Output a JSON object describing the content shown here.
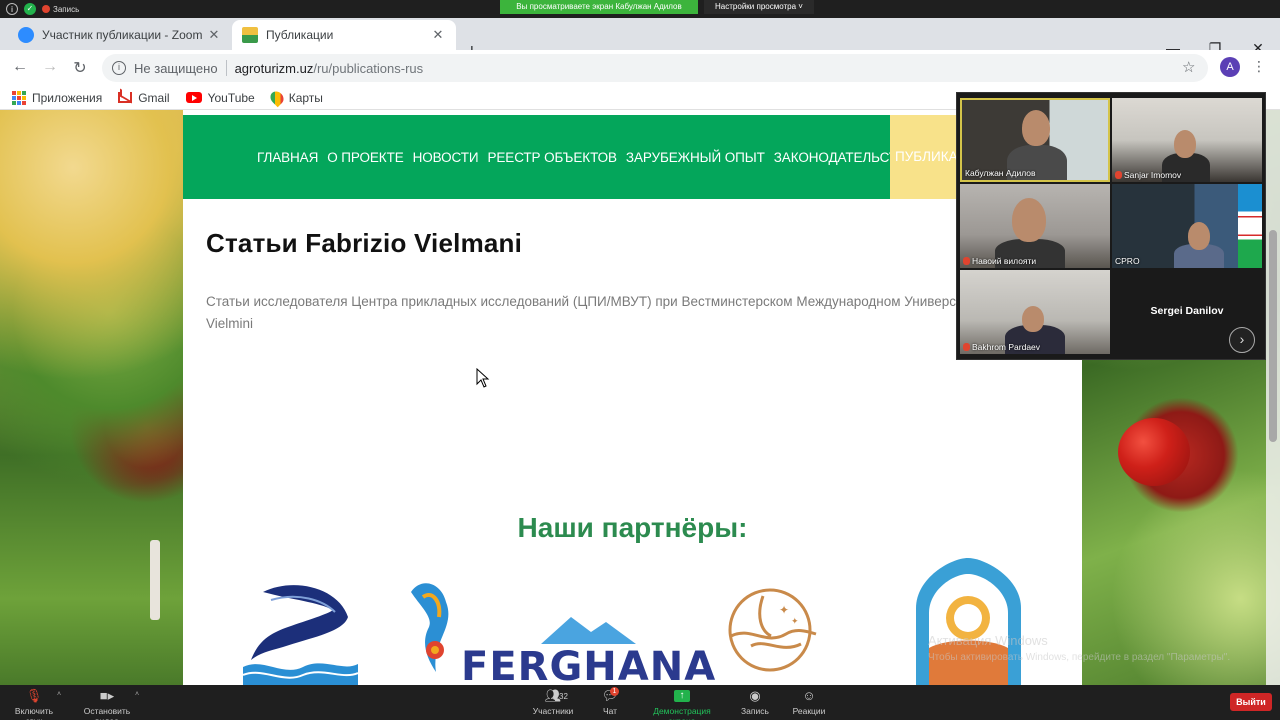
{
  "zoom_top": {
    "record_label": "Запись",
    "share_banner": "Вы просматриваете экран Кабулжан Адилов",
    "view_settings": "Настройки просмотра"
  },
  "tabs": [
    {
      "title": "Участник публикации - Zoom"
    },
    {
      "title": "Публикации"
    }
  ],
  "addressbar": {
    "insecure_label": "Не защищено",
    "url_host": "agroturizm.uz",
    "url_path": "/ru/publications-rus",
    "profile_initial": "A"
  },
  "bookmarks": [
    {
      "label": "Приложения",
      "icon": "apps-icon"
    },
    {
      "label": "Gmail",
      "icon": "gmail-icon"
    },
    {
      "label": "YouTube",
      "icon": "youtube-icon"
    },
    {
      "label": "Карты",
      "icon": "maps-icon"
    }
  ],
  "site": {
    "nav": [
      "ГЛАВНАЯ",
      "О ПРОЕКТЕ",
      "НОВОСТИ",
      "РЕЕСТР ОБЪЕКТОВ",
      "ЗАРУБЕЖНЫЙ ОПЫТ",
      "ЗАКОНОДАТЕЛЬСТВО"
    ],
    "nav_active": "ПУБЛИКА",
    "title": "Статьи Fabrizio Vielmani",
    "desc_line1": "Статьи исследователя Центра прикладных исследований (ЦПИ/МВУТ) при Вестминстерском Международном Университете",
    "desc_line2": "Vielmini",
    "partners_title": "Наши партнёры:",
    "ferghana_logo_text": "FERGHANA",
    "colors": {
      "nav_green": "#04a65b",
      "nav_active": "#f8e28a",
      "partners_green": "#2c8b4f"
    }
  },
  "watermark": {
    "line1": "Активация Windows",
    "line2": "Чтобы активировать Windows, перейдите в раздел \"Параметры\"."
  },
  "participants": [
    {
      "name": "Кабулжан Адилов"
    },
    {
      "name": "Sanjar Imomov"
    },
    {
      "name": "Навоий вилояти"
    },
    {
      "name": "CPRO"
    },
    {
      "name": "Bakhrom Pardaev"
    },
    {
      "name": "Sergei Danilov"
    }
  ],
  "zoom_bottom": {
    "mute": "Включить звук",
    "video": "Остановить видео",
    "participants": "Участники",
    "participants_count": "32",
    "chat": "Чат",
    "chat_badge": "1",
    "share": "Демонстрация экрана",
    "record": "Запись",
    "reactions": "Реакции",
    "leave": "Выйти"
  }
}
